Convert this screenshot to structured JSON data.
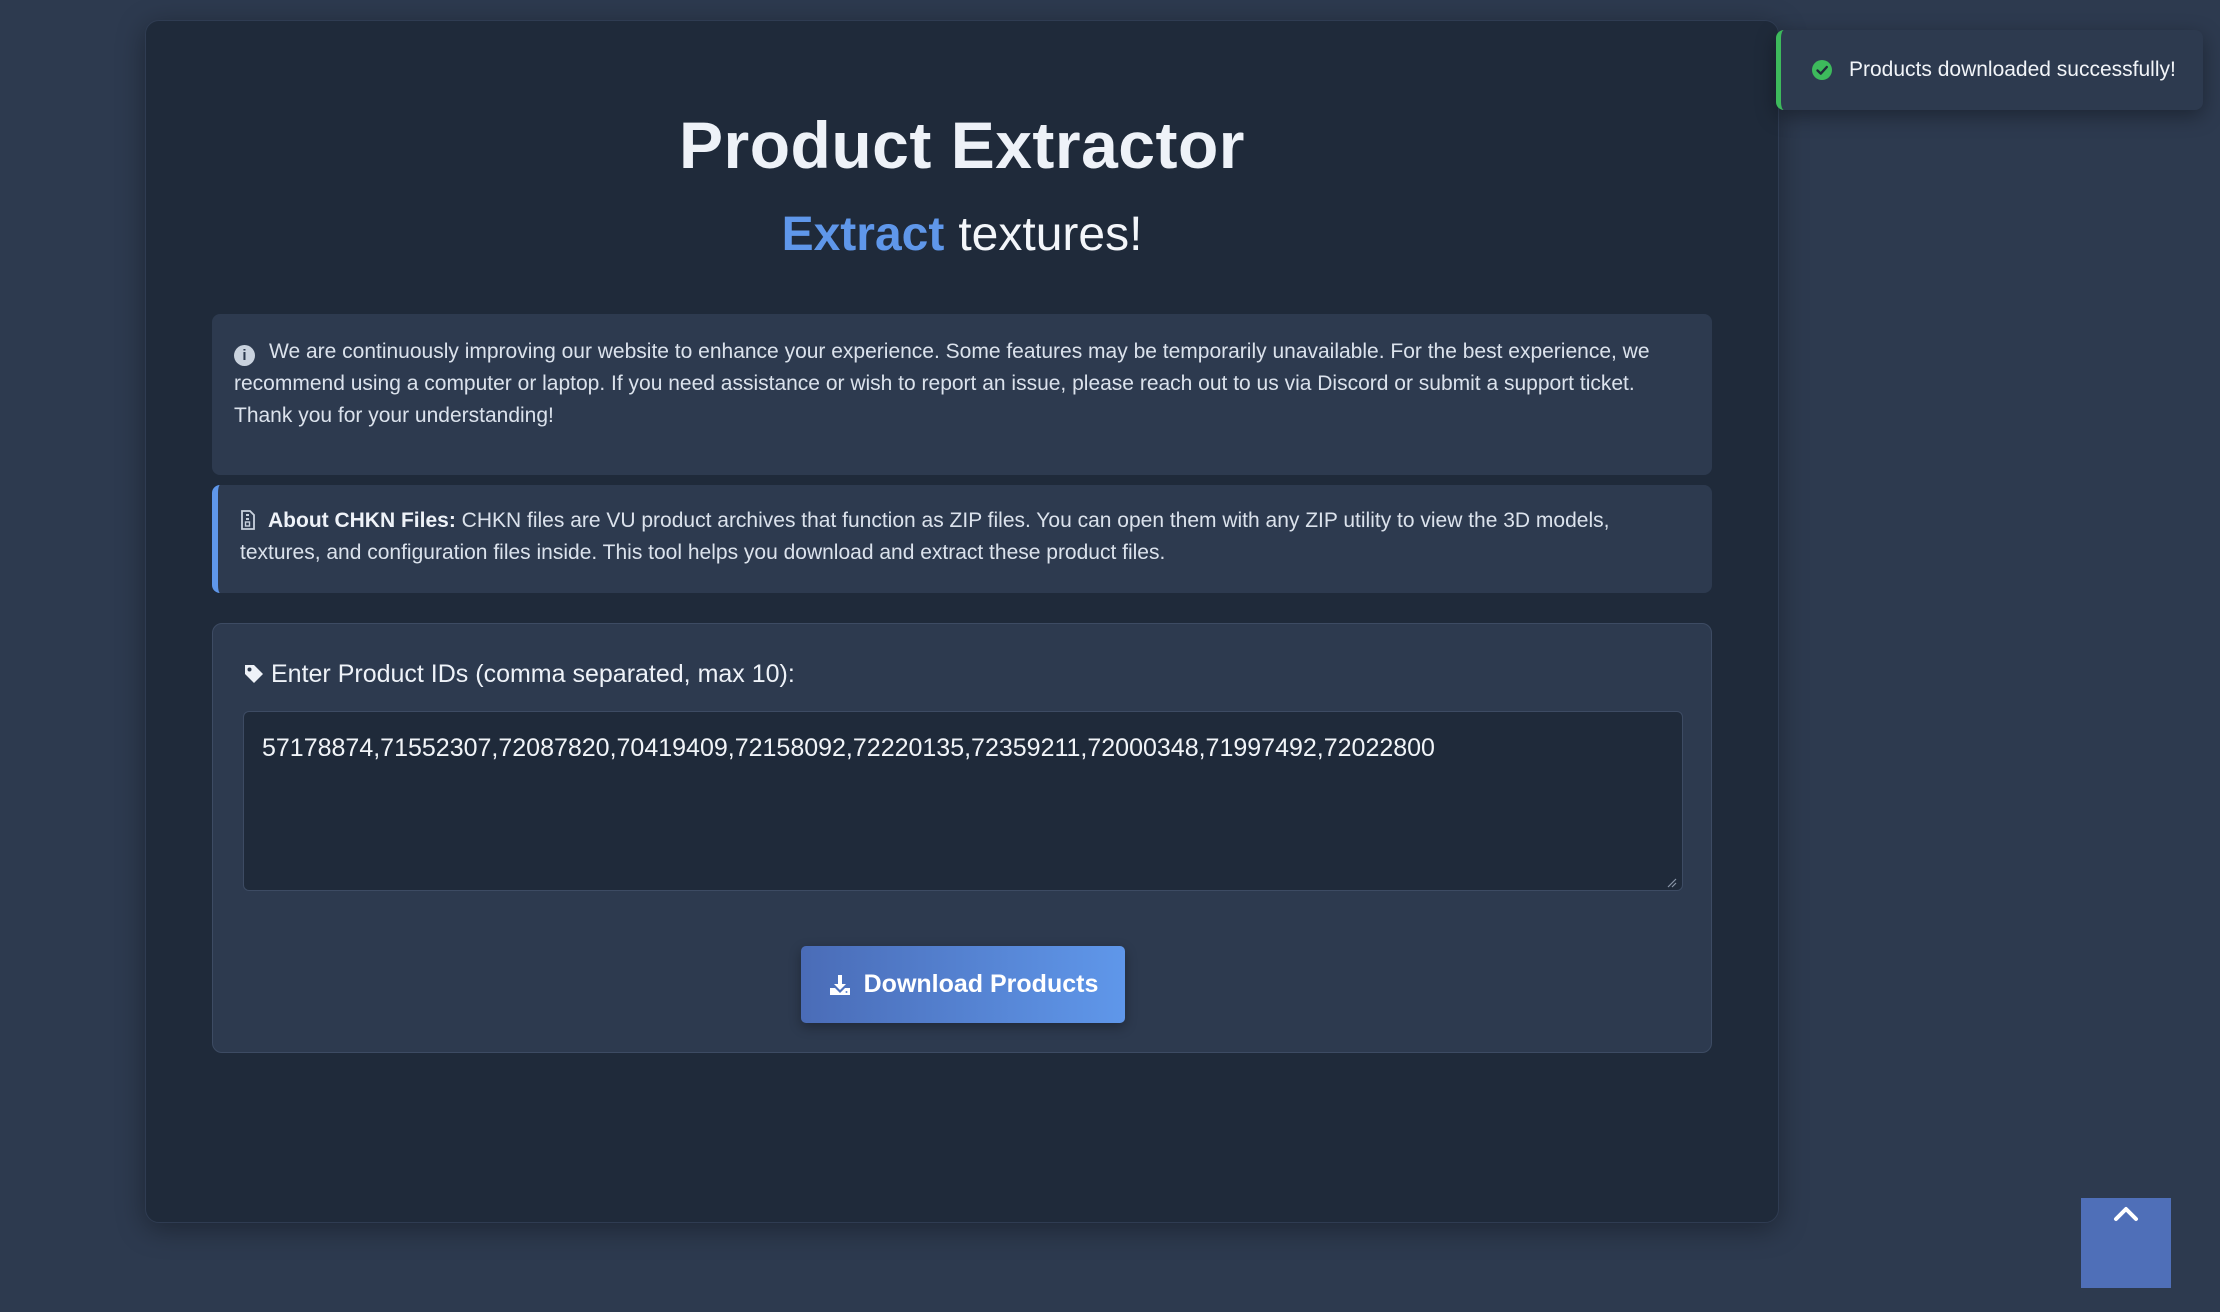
{
  "header": {
    "title": "Product Extractor",
    "subtitle_accent": "Extract",
    "subtitle_rest": "textures!"
  },
  "notice": {
    "icon": "info-circle-icon",
    "text": "We are continuously improving our website to enhance your experience. Some features may be temporarily unavailable. For the best experience, we recommend using a computer or laptop. If you need assistance or wish to report an issue, please reach out to us via Discord or submit a support ticket. Thank you for your understanding!"
  },
  "about": {
    "icon": "file-zip-icon",
    "heading": "About CHKN Files:",
    "text": "CHKN files are VU product archives that function as ZIP files. You can open them with any ZIP utility to view the 3D models, textures, and configuration files inside. This tool helps you download and extract these product files."
  },
  "form": {
    "label_icon": "tag-icon",
    "label": "Enter Product IDs (comma separated, max 10):",
    "ids_value": "57178874,71552307,72087820,70419409,72158092,72220135,72359211,72000348,71997492,72022800",
    "submit_icon": "download-icon",
    "submit_label": "Download Products"
  },
  "toast": {
    "icon": "check-circle-icon",
    "message": "Products downloaded successfully!",
    "status_color": "#3dba5c"
  },
  "scroll_top": {
    "icon": "chevron-up-icon"
  },
  "colors": {
    "page_bg": "#2d3a4f",
    "card_bg": "#1f2a3a",
    "accent": "#5f97ea",
    "button_start": "#4a6cb7"
  }
}
